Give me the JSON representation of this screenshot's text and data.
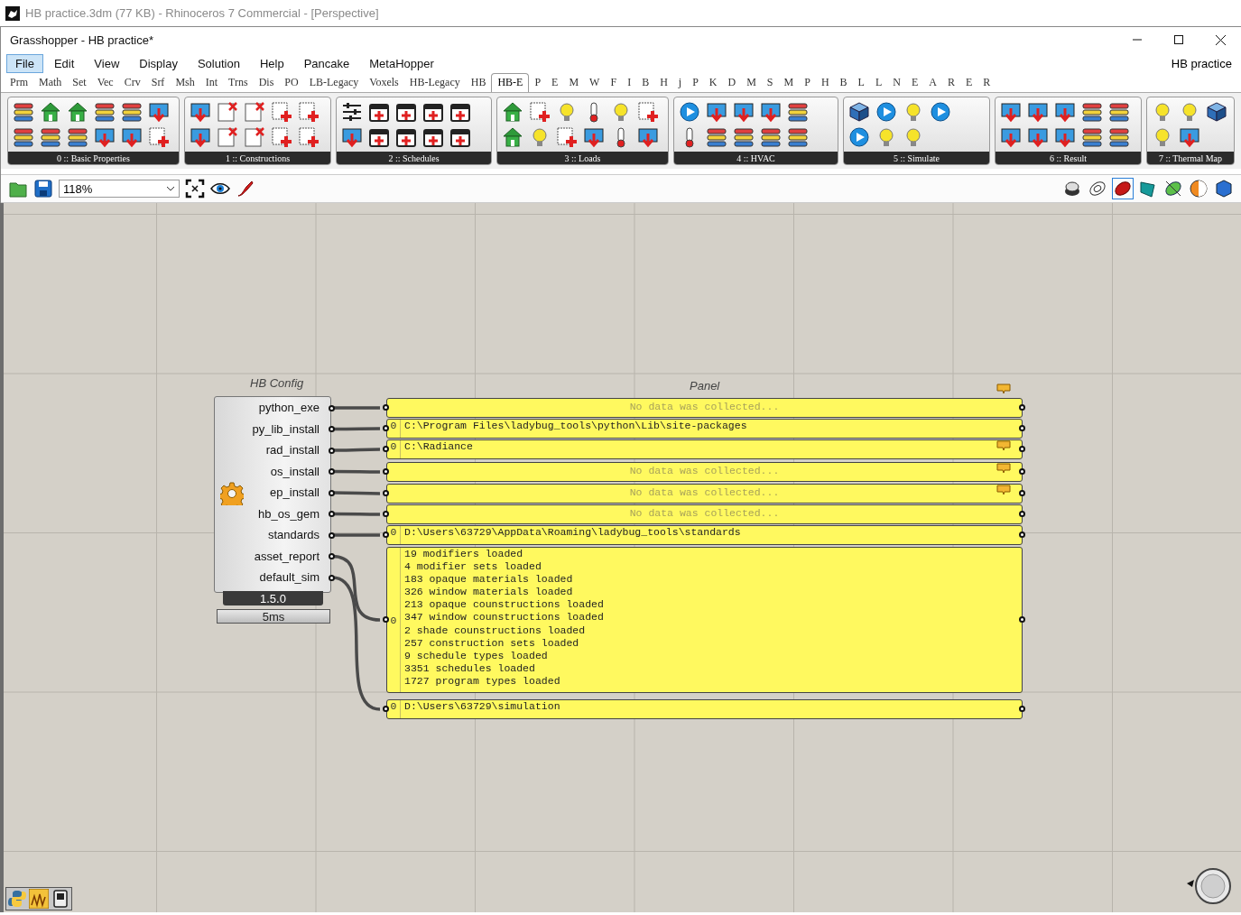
{
  "rhino_title": "HB practice.3dm (77 KB) - Rhinoceros 7 Commercial - [Perspective]",
  "window": {
    "title": "Grasshopper - HB practice*",
    "document": "HB practice"
  },
  "menu": [
    {
      "label": "File",
      "selected": true
    },
    {
      "label": "Edit",
      "selected": false
    },
    {
      "label": "View",
      "selected": false
    },
    {
      "label": "Display",
      "selected": false
    },
    {
      "label": "Solution",
      "selected": false
    },
    {
      "label": "Help",
      "selected": false
    },
    {
      "label": "Pancake",
      "selected": false
    },
    {
      "label": "MetaHopper",
      "selected": false
    }
  ],
  "tabs": [
    {
      "label": "Prm",
      "selected": false
    },
    {
      "label": "Math",
      "selected": false
    },
    {
      "label": "Set",
      "selected": false
    },
    {
      "label": "Vec",
      "selected": false
    },
    {
      "label": "Crv",
      "selected": false
    },
    {
      "label": "Srf",
      "selected": false
    },
    {
      "label": "Msh",
      "selected": false
    },
    {
      "label": "Int",
      "selected": false
    },
    {
      "label": "Trns",
      "selected": false
    },
    {
      "label": "Dis",
      "selected": false
    },
    {
      "label": "PO",
      "selected": false
    },
    {
      "label": "LB-Legacy",
      "selected": false
    },
    {
      "label": "Voxels",
      "selected": false
    },
    {
      "label": "HB-Legacy",
      "selected": false
    },
    {
      "label": "HB",
      "selected": false
    },
    {
      "label": "HB-E",
      "selected": true
    },
    {
      "label": "P",
      "selected": false
    },
    {
      "label": "E",
      "selected": false
    },
    {
      "label": "M",
      "selected": false
    },
    {
      "label": "W",
      "selected": false
    },
    {
      "label": "F",
      "selected": false
    },
    {
      "label": "I",
      "selected": false
    },
    {
      "label": "B",
      "selected": false
    },
    {
      "label": "H",
      "selected": false
    },
    {
      "label": "j",
      "selected": false
    },
    {
      "label": "P",
      "selected": false
    },
    {
      "label": "K",
      "selected": false
    },
    {
      "label": "D",
      "selected": false
    },
    {
      "label": "M",
      "selected": false
    },
    {
      "label": "S",
      "selected": false
    },
    {
      "label": "M",
      "selected": false
    },
    {
      "label": "P",
      "selected": false
    },
    {
      "label": "H",
      "selected": false
    },
    {
      "label": "B",
      "selected": false
    },
    {
      "label": "L",
      "selected": false
    },
    {
      "label": "L",
      "selected": false
    },
    {
      "label": "N",
      "selected": false
    },
    {
      "label": "E",
      "selected": false
    },
    {
      "label": "A",
      "selected": false
    },
    {
      "label": "R",
      "selected": false
    },
    {
      "label": "E",
      "selected": false
    },
    {
      "label": "R",
      "selected": false
    }
  ],
  "ribbon_groups": [
    {
      "label": "0 :: Basic Properties"
    },
    {
      "label": "1 :: Constructions"
    },
    {
      "label": "2 :: Schedules"
    },
    {
      "label": "3 :: Loads"
    },
    {
      "label": "4 :: HVAC"
    },
    {
      "label": "5 :: Simulate"
    },
    {
      "label": "6 :: Result"
    },
    {
      "label": "7 :: Thermal Map"
    }
  ],
  "toolbar": {
    "zoom": "118%"
  },
  "canvas": {
    "component": {
      "name": "HB Config",
      "outputs": [
        "python_exe",
        "py_lib_install",
        "rad_install",
        "os_install",
        "ep_install",
        "hb_os_gem",
        "standards",
        "asset_report",
        "default_sim"
      ],
      "version": "1.5.0",
      "time": "5ms"
    },
    "panel_label": "Panel",
    "panels": [
      {
        "kind": "empty",
        "text": "No data was collected...",
        "marker": true
      },
      {
        "kind": "data",
        "index": "0",
        "lines": [
          "C:\\Program Files\\ladybug_tools\\python\\Lib\\site-packages"
        ],
        "marker": false
      },
      {
        "kind": "data",
        "index": "0",
        "lines": [
          "C:\\Radiance"
        ],
        "marker": true
      },
      {
        "kind": "empty",
        "text": "No data was collected...",
        "marker": true
      },
      {
        "kind": "empty",
        "text": "No data was collected...",
        "marker": true
      },
      {
        "kind": "empty",
        "text": "No data was collected...",
        "marker": false
      },
      {
        "kind": "data",
        "index": "0",
        "lines": [
          "D:\\Users\\63729\\AppData\\Roaming\\ladybug_tools\\standards"
        ],
        "marker": false
      },
      {
        "kind": "data",
        "index": "0",
        "lines": [
          "19 modifiers loaded",
          "4 modifier sets loaded",
          "183 opaque materials loaded",
          "326 window materials loaded",
          "213 opaque counstructions loaded",
          "347 window counstructions loaded",
          "2 shade counstructions loaded",
          "257 construction sets loaded",
          "9 schedule types loaded",
          "3351 schedules loaded",
          "1727 program types loaded"
        ],
        "marker": false
      },
      {
        "kind": "data",
        "index": "0",
        "lines": [
          "D:\\Users\\63729\\simulation"
        ],
        "marker": false
      }
    ]
  }
}
